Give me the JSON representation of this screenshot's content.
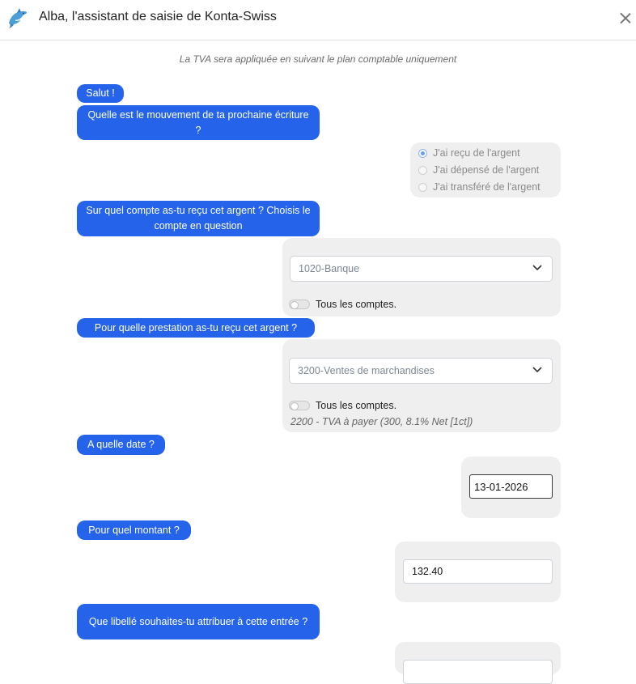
{
  "header": {
    "title": "Alba, l'assistant de saisie de Konta-Swiss",
    "logo_icon": "dolphin-icon",
    "close_icon": "close-icon"
  },
  "notice": "La TVA sera appliquée en suivant le plan comptable uniquement",
  "messages": {
    "greeting": "Salut !",
    "q_movement": "Quelle est le mouvement de ta prochaine écriture ?",
    "q_account": "Sur quel compte as-tu reçu cet argent ? Choisis le compte en question",
    "q_service": "Pour quelle prestation as-tu reçu cet argent ?",
    "q_date": "A quelle date ?",
    "q_amount": "Pour quel montant ?",
    "q_label": "Que libellé souhaites-tu attribuer à cette entrée ?"
  },
  "movement_options": [
    {
      "label": "J'ai reçu de l'argent",
      "checked": true
    },
    {
      "label": "J'ai dépensé de l'argent",
      "checked": false
    },
    {
      "label": "J'ai transféré de l'argent",
      "checked": false
    }
  ],
  "account_select": {
    "value": "1020-Banque",
    "toggle_label": "Tous les comptes.",
    "toggle_on": false
  },
  "service_select": {
    "value": "3200-Ventes de marchandises",
    "toggle_label": "Tous les comptes.",
    "toggle_on": false,
    "vat_note": "2200 - TVA à payer (300, 8.1% Net [1ct])"
  },
  "date_input": {
    "value": "13-01-2026"
  },
  "amount_input": {
    "value": "132.40"
  },
  "colors": {
    "accent": "#2563eb",
    "panel": "#efefef"
  }
}
